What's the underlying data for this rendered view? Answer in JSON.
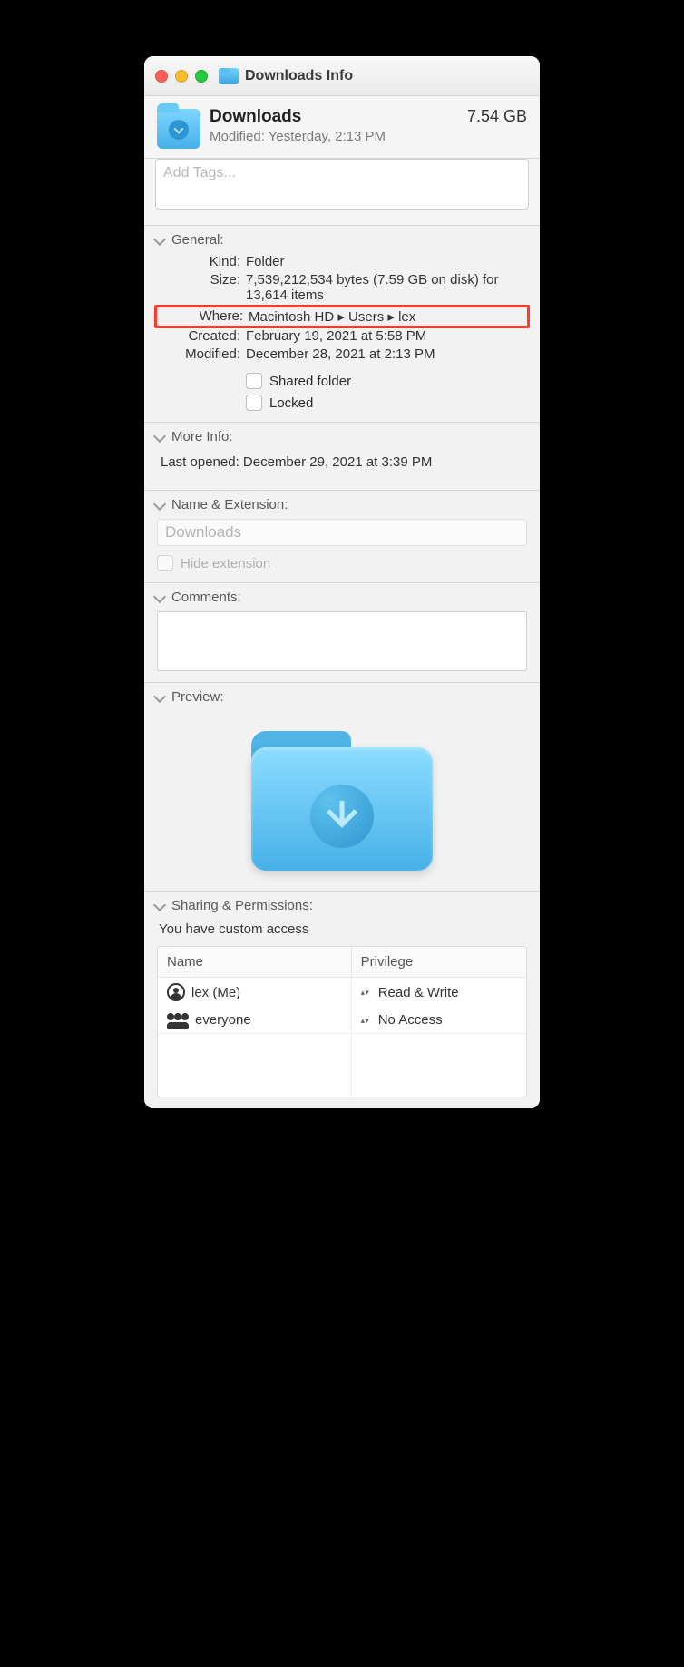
{
  "titlebar": {
    "title": "Downloads Info"
  },
  "summary": {
    "name": "Downloads",
    "size": "7.54 GB",
    "modified_label": "Modified:",
    "modified_value": "Yesterday, 2:13 PM"
  },
  "tags": {
    "placeholder": "Add Tags..."
  },
  "sections": {
    "general": {
      "header": "General:",
      "kind_label": "Kind:",
      "kind_value": "Folder",
      "size_label": "Size:",
      "size_value": "7,539,212,534 bytes (7.59 GB on disk) for 13,614 items",
      "where_label": "Where:",
      "where_value": "Macintosh HD ▸ Users ▸ lex",
      "created_label": "Created:",
      "created_value": "February 19, 2021 at 5:58 PM",
      "modified_label": "Modified:",
      "modified_value": "December 28, 2021 at 2:13 PM",
      "shared_folder_label": "Shared folder",
      "locked_label": "Locked"
    },
    "more_info": {
      "header": "More Info:",
      "last_opened_label": "Last opened:",
      "last_opened_value": "December 29, 2021 at 3:39 PM"
    },
    "name_ext": {
      "header": "Name & Extension:",
      "value": "Downloads",
      "hide_extension_label": "Hide extension"
    },
    "comments": {
      "header": "Comments:"
    },
    "preview": {
      "header": "Preview:"
    },
    "sharing": {
      "header": "Sharing & Permissions:",
      "message": "You have custom access",
      "col_name": "Name",
      "col_priv": "Privilege",
      "rows": [
        {
          "name": "lex (Me)",
          "priv": "Read & Write"
        },
        {
          "name": "everyone",
          "priv": "No Access"
        }
      ]
    }
  }
}
